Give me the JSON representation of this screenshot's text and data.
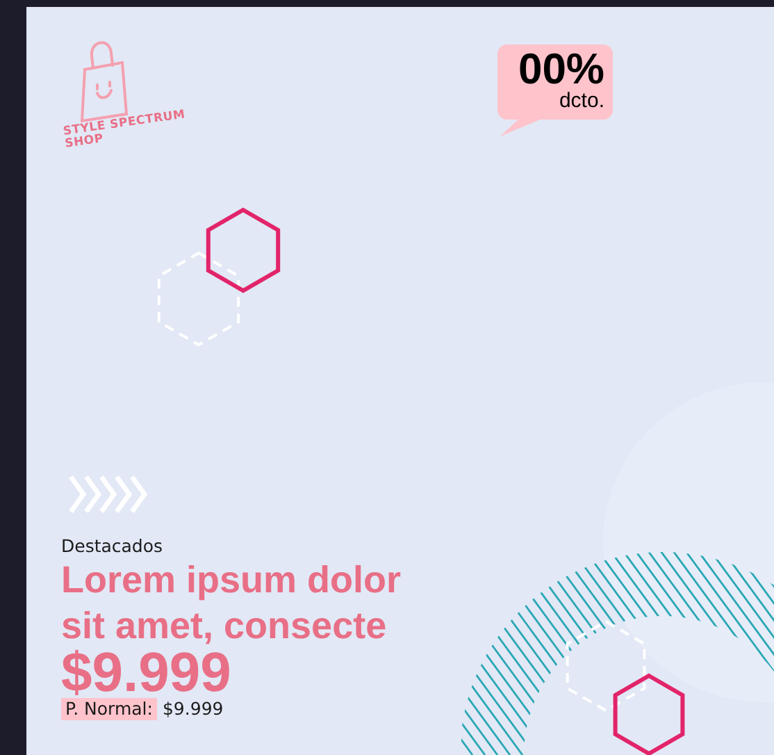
{
  "logo": {
    "lines": [
      "STYLE SPECTRUM",
      "SHOP"
    ]
  },
  "discount_badge": {
    "value": "00%",
    "label": "dcto."
  },
  "product": {
    "category": "Destacados",
    "title": "Lorem ipsum dolor sit amet, consecte",
    "price": "$9.999",
    "normal_price_label": "P. Normal:",
    "normal_price": "$9.999"
  }
}
